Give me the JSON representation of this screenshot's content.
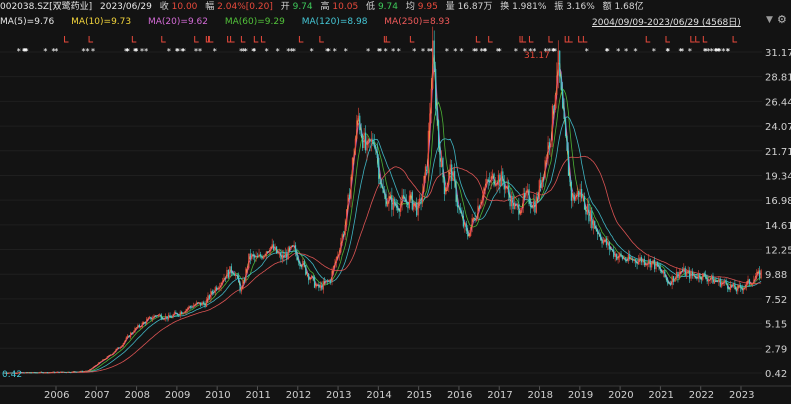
{
  "header": {
    "symbol": "002038.SZ[双鹭药业]",
    "date": "2023/06/29",
    "close_label": "收",
    "close": "10.00",
    "change_label": "幅",
    "change": "2.04%[0.20]",
    "open_label": "开",
    "open": "9.74",
    "high_label": "高",
    "high": "10.05",
    "low_label": "低",
    "low": "9.74",
    "avg_label": "均",
    "avg": "9.95",
    "volume_label": "量",
    "volume": "16.87万",
    "turnover_label": "换",
    "turnover": "1.981%",
    "amplitude_label": "振",
    "amplitude": "3.16%",
    "amount_label": "额",
    "amount": "1.68亿",
    "range": "2004/09/09-2023/06/29 (4568日)"
  },
  "ma": [
    {
      "label": "MA(5)=9.76",
      "color": "#e8e8e8"
    },
    {
      "label": "MA(10)=9.73",
      "color": "#f2d43b"
    },
    {
      "label": "MA(20)=9.62",
      "color": "#d36bd6"
    },
    {
      "label": "MA(60)=9.29",
      "color": "#52c23a"
    },
    {
      "label": "MA(120)=8.98",
      "color": "#45c7d6"
    },
    {
      "label": "MA(250)=8.93",
      "color": "#f05a5a"
    }
  ],
  "colors": {
    "up": "#e84a3c",
    "down": "#3ec8c8",
    "background": "#131313"
  },
  "icons": {
    "settings": "gear-icon",
    "range_dropdown": "caret-down-icon"
  },
  "chart_data": {
    "type": "candlestick",
    "scale": "log",
    "y_ticks": [
      "31.17",
      "28.81",
      "26.44",
      "24.07",
      "21.71",
      "19.34",
      "16.98",
      "14.61",
      "12.25",
      "9.88",
      "7.52",
      "5.15",
      "2.79",
      "0.42"
    ],
    "x_ticks": [
      "2006",
      "2007",
      "2008",
      "2009",
      "2010",
      "2011",
      "2012",
      "2013",
      "2014",
      "2015",
      "2016",
      "2017",
      "2018",
      "2019",
      "2020",
      "2021",
      "2022",
      "2023"
    ],
    "max_label": "31.17",
    "min_label": "0.42",
    "price_path": [
      [
        "2004.7",
        0.42
      ],
      [
        "2005.5",
        0.45
      ],
      [
        "2006.3",
        0.5
      ],
      [
        "2006.8",
        0.6
      ],
      [
        "2007.0",
        1.2
      ],
      [
        "2007.3",
        2.0
      ],
      [
        "2007.6",
        3.0
      ],
      [
        "2007.9",
        4.4
      ],
      [
        "2008.2",
        5.3
      ],
      [
        "2008.5",
        6.0
      ],
      [
        "2008.8",
        5.7
      ],
      [
        "2009.1",
        6.3
      ],
      [
        "2009.4",
        6.9
      ],
      [
        "2009.7",
        7.1
      ],
      [
        "2009.9",
        8.3
      ],
      [
        "2010.2",
        9.8
      ],
      [
        "2010.4",
        10.4
      ],
      [
        "2010.6",
        8.2
      ],
      [
        "2010.8",
        11.6
      ],
      [
        "2011.0",
        11.3
      ],
      [
        "2011.3",
        12.6
      ],
      [
        "2011.6",
        11.4
      ],
      [
        "2011.9",
        12.3
      ],
      [
        "2012.2",
        10.2
      ],
      [
        "2012.5",
        8.5
      ],
      [
        "2012.8",
        9.3
      ],
      [
        "2013.0",
        12.0
      ],
      [
        "2013.2",
        15.0
      ],
      [
        "2013.4",
        22.0
      ],
      [
        "2013.5",
        25.0
      ],
      [
        "2013.7",
        21.5
      ],
      [
        "2013.9",
        23.0
      ],
      [
        "2014.1",
        17.5
      ],
      [
        "2014.4",
        16.5
      ],
      [
        "2014.8",
        17.0
      ],
      [
        "2015.0",
        16.0
      ],
      [
        "2015.2",
        20.0
      ],
      [
        "2015.35",
        31.0
      ],
      [
        "2015.5",
        22.0
      ],
      [
        "2015.65",
        18.0
      ],
      [
        "2015.8",
        20.0
      ],
      [
        "2016.0",
        16.0
      ],
      [
        "2016.2",
        13.5
      ],
      [
        "2016.4",
        15.5
      ],
      [
        "2016.6",
        18.0
      ],
      [
        "2016.9",
        19.3
      ],
      [
        "2017.1",
        18.8
      ],
      [
        "2017.4",
        16.0
      ],
      [
        "2017.7",
        17.3
      ],
      [
        "2017.9",
        16.5
      ],
      [
        "2018.1",
        20.0
      ],
      [
        "2018.3",
        24.0
      ],
      [
        "2018.45",
        30.5
      ],
      [
        "2018.6",
        24.0
      ],
      [
        "2018.8",
        17.0
      ],
      [
        "2019.0",
        17.8
      ],
      [
        "2019.3",
        15.0
      ],
      [
        "2019.6",
        13.0
      ],
      [
        "2019.9",
        11.7
      ],
      [
        "2020.2",
        11.2
      ],
      [
        "2020.5",
        11.3
      ],
      [
        "2020.8",
        11.0
      ],
      [
        "2021.0",
        10.2
      ],
      [
        "2021.2",
        9.1
      ],
      [
        "2021.5",
        10.2
      ],
      [
        "2021.8",
        9.7
      ],
      [
        "2022.0",
        9.8
      ],
      [
        "2022.3",
        9.3
      ],
      [
        "2022.6",
        9.0
      ],
      [
        "2022.9",
        8.4
      ],
      [
        "2023.1",
        8.8
      ],
      [
        "2023.3",
        9.4
      ],
      [
        "2023.5",
        10.0
      ]
    ]
  }
}
